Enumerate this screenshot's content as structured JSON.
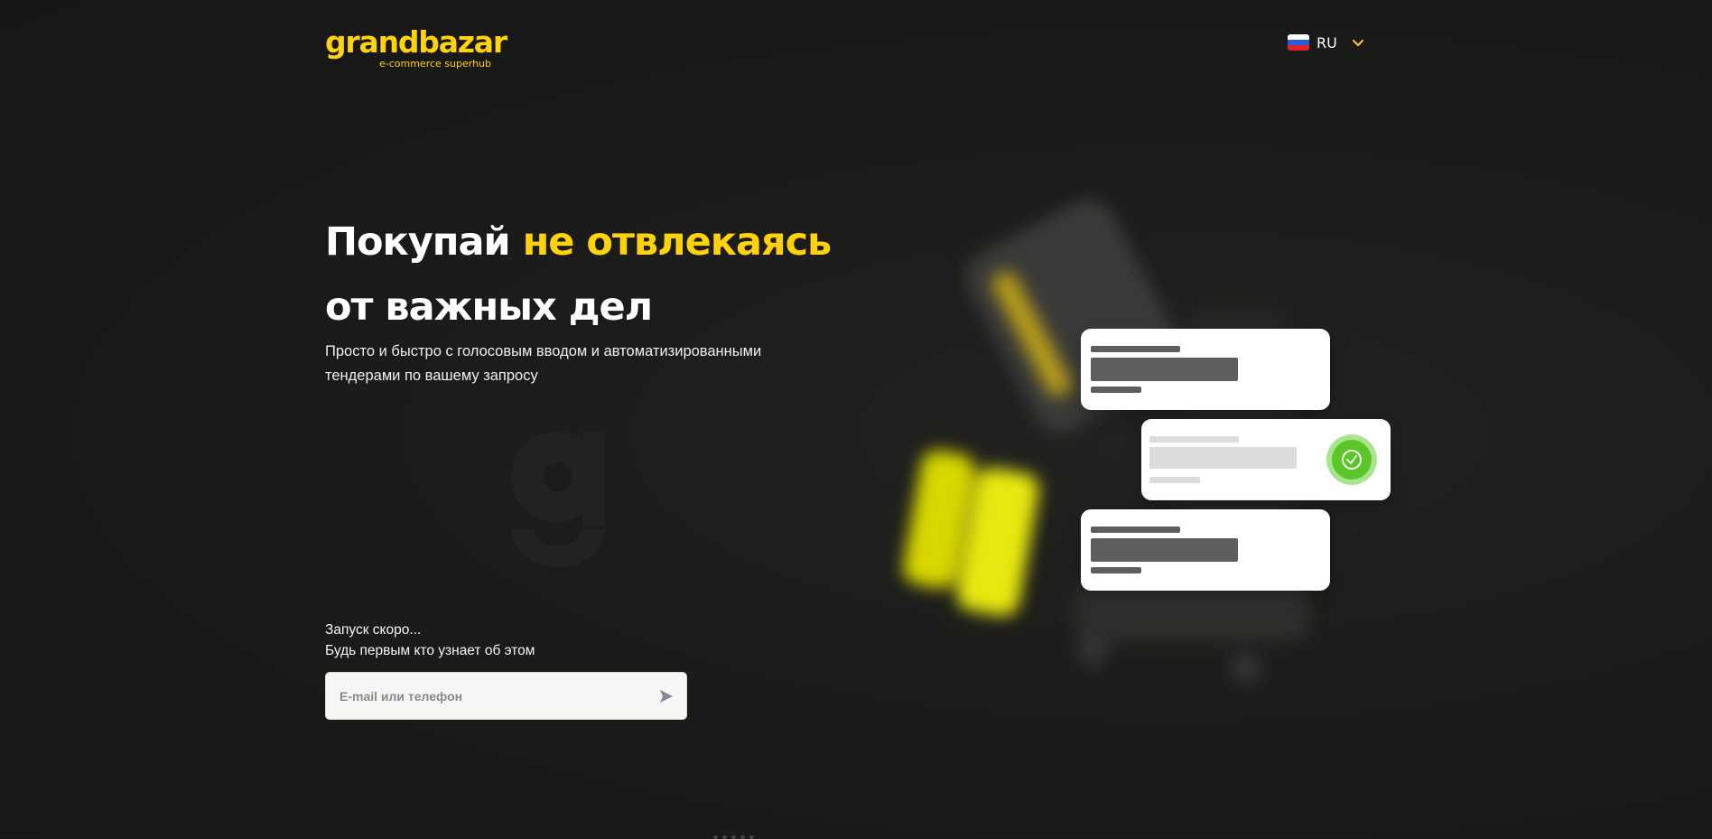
{
  "header": {
    "logo_text": "grandbazar",
    "logo_tagline": "e-commerce superhub",
    "language": {
      "flag_icon": "russia-flag-icon",
      "label": "RU",
      "toggle_icon": "chevron-down-icon"
    }
  },
  "hero": {
    "headline_part1": "Покупай ",
    "headline_accent": "не отвлекаясь",
    "headline_part2": "от важных дел",
    "subtitle": "Просто и быстро с голосовым вводом и автоматизированными тендерами по вашему запросу",
    "launch_line1": "Запуск скоро...",
    "launch_line2": "Будь первым кто узнает об этом"
  },
  "signup": {
    "placeholder": "E-mail или телефон",
    "value": "",
    "submit_icon": "send-arrow-icon"
  },
  "illustration": {
    "status_icon": "check-circle-icon"
  },
  "colors": {
    "background": "#1a1a18",
    "accent": "#ffd20a",
    "success": "#5cc52a",
    "text": "#ffffff"
  }
}
